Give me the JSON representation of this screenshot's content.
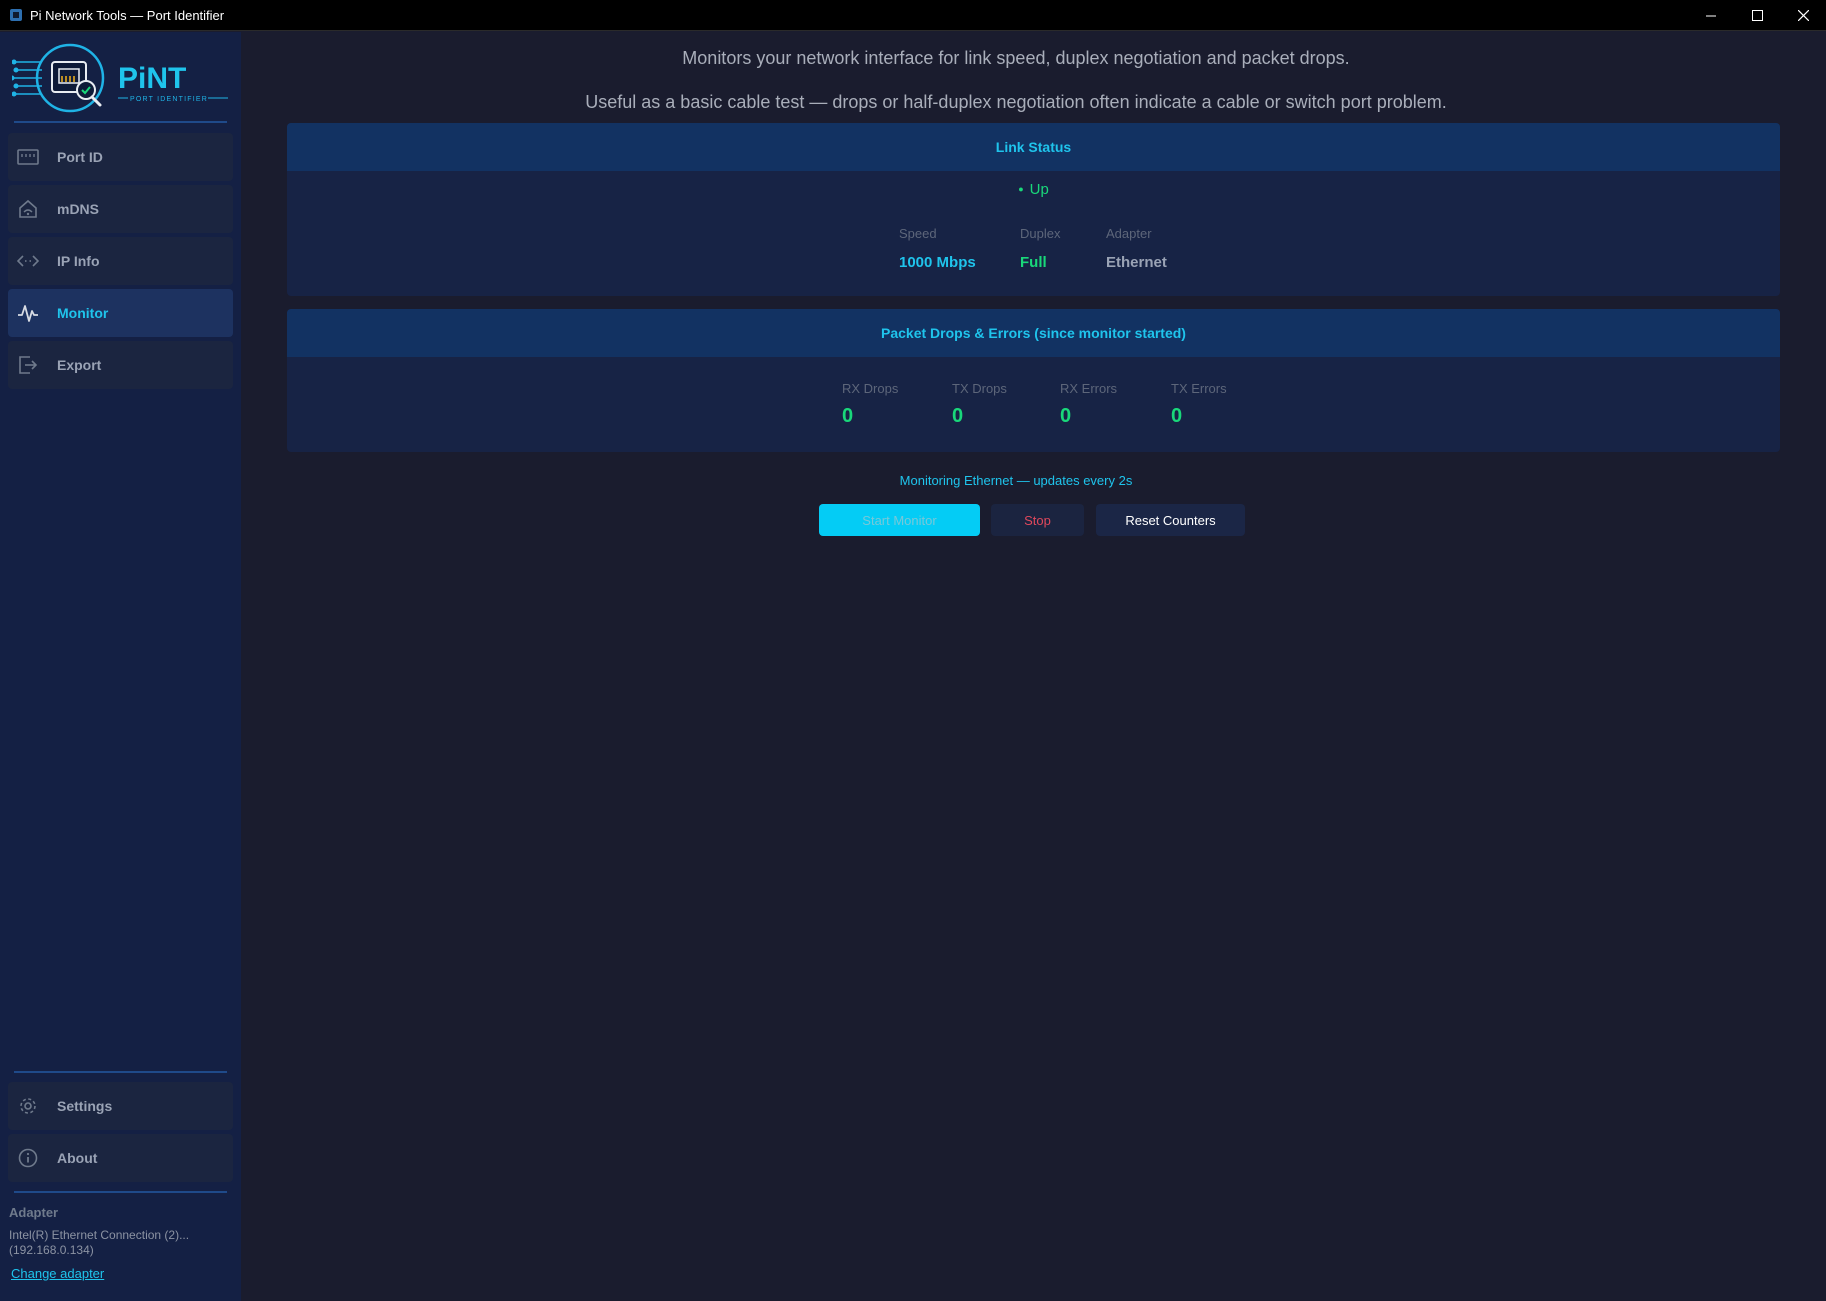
{
  "window": {
    "title": "Pi Network Tools — Port Identifier"
  },
  "sidebar": {
    "logo": {
      "name": "PiNT",
      "tagline": "PORT IDENTIFIER"
    },
    "items": [
      {
        "label": "Port ID",
        "icon": "ethernet-port-icon",
        "active": false
      },
      {
        "label": "mDNS",
        "icon": "broadcast-home-icon",
        "active": false
      },
      {
        "label": "IP Info",
        "icon": "code-arrows-icon",
        "active": false
      },
      {
        "label": "Monitor",
        "icon": "pulse-icon",
        "active": true
      },
      {
        "label": "Export",
        "icon": "export-icon",
        "active": false
      }
    ],
    "bottom_items": [
      {
        "label": "Settings",
        "icon": "gear-icon"
      },
      {
        "label": "About",
        "icon": "info-icon"
      }
    ],
    "adapter": {
      "header": "Adapter",
      "name": "Intel(R) Ethernet Connection (2)...",
      "ip": "(192.168.0.134)",
      "change_link": "Change adapter"
    }
  },
  "main": {
    "description_1": "Monitors your network interface for link speed, duplex negotiation and packet drops.",
    "description_2": "Useful as a basic cable test — drops or half-duplex negotiation often indicate a cable or switch port problem.",
    "link_status": {
      "title": "Link Status",
      "state": "Up",
      "speed_label": "Speed",
      "speed": "1000 Mbps",
      "duplex_label": "Duplex",
      "duplex": "Full",
      "adapter_label": "Adapter",
      "adapter": "Ethernet"
    },
    "packets": {
      "title": "Packet Drops & Errors  (since monitor started)",
      "rx_drops_label": "RX Drops",
      "rx_drops": "0",
      "tx_drops_label": "TX Drops",
      "tx_drops": "0",
      "rx_errors_label": "RX Errors",
      "rx_errors": "0",
      "tx_errors_label": "TX Errors",
      "tx_errors": "0"
    },
    "monitor_status": "Monitoring Ethernet — updates every 2s",
    "buttons": {
      "start": "Start Monitor",
      "stop": "Stop",
      "reset": "Reset Counters"
    }
  },
  "colors": {
    "accent": "#1fc4ec",
    "success": "#19d87a",
    "danger": "#e0485c",
    "sidebar_bg": "#142044",
    "main_bg": "#1a1c2e"
  }
}
